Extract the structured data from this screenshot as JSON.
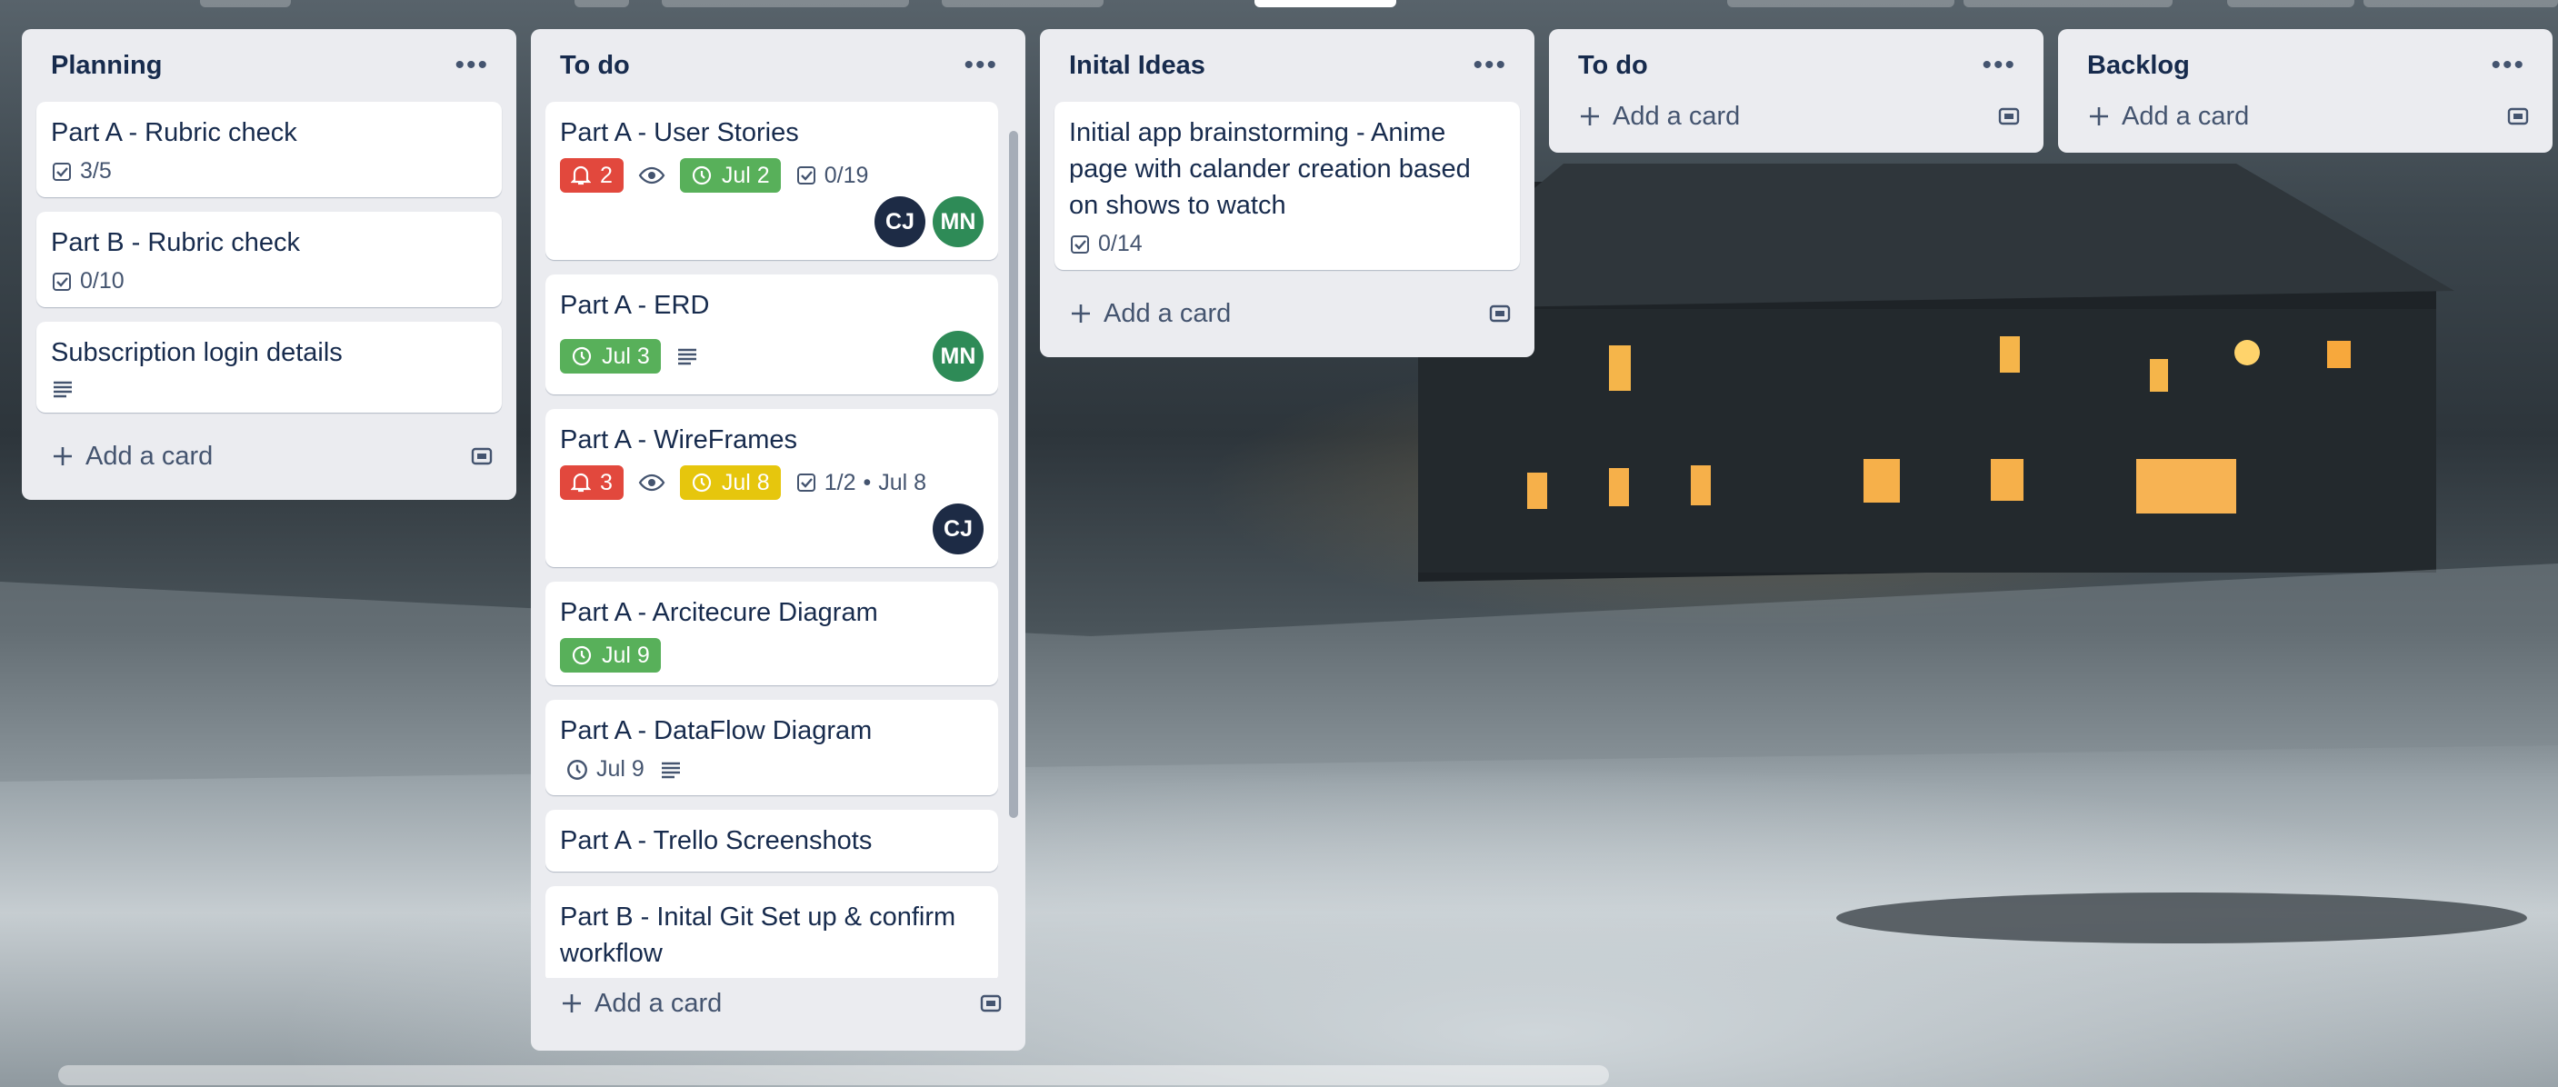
{
  "colors": {
    "red": "#e2483d",
    "green": "#58b05a",
    "yellow": "#e6c60d",
    "avatar_cj": "#1d2b45",
    "avatar_mn": "#2e8b57"
  },
  "lists": [
    {
      "title": "Planning",
      "cards": [
        {
          "title": "Part A - Rubric check",
          "checklist": "3/5"
        },
        {
          "title": "Part B - Rubric check",
          "checklist": "0/10"
        },
        {
          "title": "Subscription login details"
        }
      ],
      "add_label": "Add a card"
    },
    {
      "title": "To do",
      "cards": [
        {
          "title": "Part A - User Stories",
          "notifications": "2",
          "due": "Jul 2",
          "checklist": "0/19",
          "members": [
            "CJ",
            "MN"
          ]
        },
        {
          "title": "Part A - ERD",
          "due": "Jul 3",
          "members": [
            "MN"
          ]
        },
        {
          "title": "Part A - WireFrames",
          "notifications": "3",
          "due": "Jul 8",
          "checklist": "1/2",
          "checklist_due": "Jul 8",
          "members": [
            "CJ"
          ]
        },
        {
          "title": "Part A - Arcitecure Diagram",
          "due": "Jul 9"
        },
        {
          "title": "Part A - DataFlow Diagram",
          "due": "Jul 9"
        },
        {
          "title": "Part A - Trello Screenshots"
        },
        {
          "title": "Part B - Inital Git Set up & confirm workflow"
        }
      ],
      "add_label": "Add a card"
    },
    {
      "title": "Inital Ideas",
      "cards": [
        {
          "title": "Initial app brainstorming - Anime page with calander creation based on shows to watch",
          "checklist": "0/14"
        }
      ],
      "add_label": "Add a card"
    },
    {
      "title": "To do",
      "cards": [],
      "add_label": "Add a card"
    },
    {
      "title": "Backlog",
      "cards": [],
      "add_label": "Add a card"
    }
  ]
}
